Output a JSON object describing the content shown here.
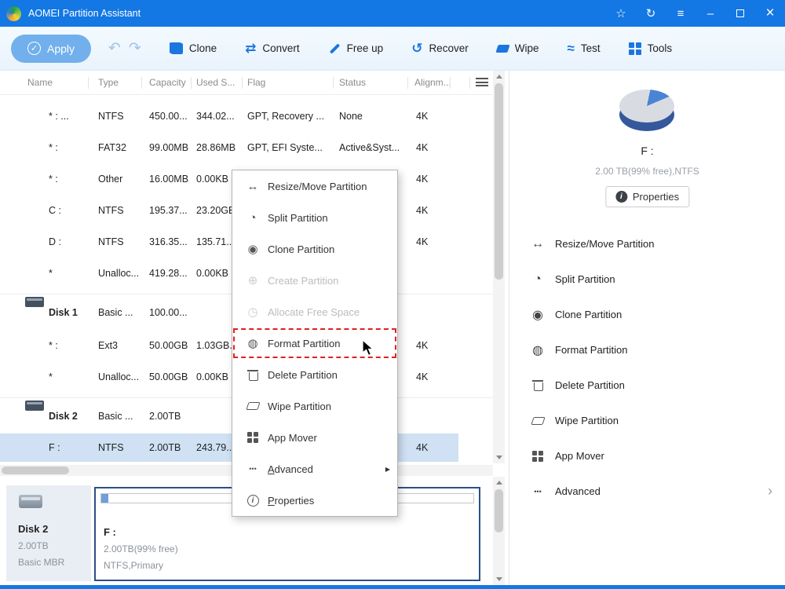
{
  "titlebar": {
    "title": "AOMEI Partition Assistant"
  },
  "icons": {
    "star": "☆",
    "refresh": "↻",
    "menu": "≡",
    "minimize": "–",
    "close": "×",
    "apply_check": "✓",
    "undo": "↶",
    "redo": "↷",
    "convert": "⇄",
    "recover": "↺",
    "test": "≈",
    "resize": "↔",
    "split": "◔",
    "clone_p": "◉",
    "create": "⊕",
    "allocate": "◷",
    "format": "◍",
    "advanced_dots": "•••",
    "submenu_arrow": "▶",
    "chevron": "›",
    "info": "i"
  },
  "toolbar": {
    "apply_label": "Apply",
    "buttons": [
      {
        "label": "Clone"
      },
      {
        "label": "Convert"
      },
      {
        "label": "Free up"
      },
      {
        "label": "Recover"
      },
      {
        "label": "Wipe"
      },
      {
        "label": "Test"
      },
      {
        "label": "Tools"
      }
    ]
  },
  "table": {
    "columns": [
      "Name",
      "Type",
      "Capacity",
      "Used S...",
      "Flag",
      "Status",
      "Alignm..."
    ],
    "rows": [
      {
        "name": "* : ...",
        "type": "NTFS",
        "capacity": "450.00...",
        "used": "344.02...",
        "flag": "GPT, Recovery ...",
        "status": "None",
        "align": "4K"
      },
      {
        "name": "* :",
        "type": "FAT32",
        "capacity": "99.00MB",
        "used": "28.86MB",
        "flag": "GPT, EFI Syste...",
        "status": "Active&Syst...",
        "align": "4K"
      },
      {
        "name": "* :",
        "type": "Other",
        "capacity": "16.00MB",
        "used": "0.00KB",
        "flag": "",
        "status": "",
        "align": "4K"
      },
      {
        "name": "C :",
        "type": "NTFS",
        "capacity": "195.37...",
        "used": "23.20GB",
        "flag": "",
        "status": "",
        "align": "4K"
      },
      {
        "name": "D :",
        "type": "NTFS",
        "capacity": "316.35...",
        "used": "135.71...",
        "flag": "",
        "status": "",
        "align": "4K"
      },
      {
        "name": "*",
        "type": "Unalloc...",
        "capacity": "419.28...",
        "used": "0.00KB",
        "flag": "",
        "status": "",
        "align": ""
      },
      {
        "name": "Disk 1",
        "type": "Basic ...",
        "capacity": "100.00...",
        "used": "",
        "flag": "",
        "status": "",
        "align": ""
      },
      {
        "name": "* :",
        "type": "Ext3",
        "capacity": "50.00GB",
        "used": "1.03GB...",
        "flag": "",
        "status": "",
        "align": "4K"
      },
      {
        "name": "*",
        "type": "Unalloc...",
        "capacity": "50.00GB",
        "used": "0.00KB",
        "flag": "",
        "status": "",
        "align": "4K"
      },
      {
        "name": "Disk 2",
        "type": "Basic ...",
        "capacity": "2.00TB",
        "used": "",
        "flag": "",
        "status": "",
        "align": ""
      },
      {
        "name": "F :",
        "type": "NTFS",
        "capacity": "2.00TB",
        "used": "243.79...",
        "flag": "",
        "status": "",
        "align": "4K"
      }
    ]
  },
  "context_menu": {
    "items": [
      {
        "label": "Resize/Move Partition",
        "enabled": true
      },
      {
        "label": "Split Partition",
        "enabled": true
      },
      {
        "label": "Clone Partition",
        "enabled": true
      },
      {
        "label": "Create Partition",
        "enabled": false
      },
      {
        "label": "Allocate Free Space",
        "enabled": false
      },
      {
        "label": "Format Partition",
        "enabled": true,
        "highlighted": true
      },
      {
        "label": "Delete Partition",
        "enabled": true
      },
      {
        "label": "Wipe Partition",
        "enabled": true
      },
      {
        "label": "App Mover",
        "enabled": true
      },
      {
        "label": "Advanced",
        "enabled": true,
        "submenu": true
      },
      {
        "label": "Properties",
        "enabled": true
      }
    ]
  },
  "right_panel": {
    "partition_name": "F :",
    "partition_info": "2.00 TB(99% free),NTFS",
    "properties_label": "Properties",
    "actions": [
      {
        "label": "Resize/Move Partition"
      },
      {
        "label": "Split Partition"
      },
      {
        "label": "Clone Partition"
      },
      {
        "label": "Format Partition"
      },
      {
        "label": "Delete Partition"
      },
      {
        "label": "Wipe Partition"
      },
      {
        "label": "App Mover"
      },
      {
        "label": "Advanced",
        "chevron": true
      }
    ]
  },
  "bottom_panel": {
    "disk_name": "Disk 2",
    "disk_size": "2.00TB",
    "disk_type": "Basic MBR",
    "partition_name": "F :",
    "partition_size": "2.00TB(99% free)",
    "partition_fs": "NTFS,Primary"
  },
  "colors": {
    "titlebar_blue": "#1377e4",
    "accent_blue": "#1b76e0",
    "selection_blue": "#cfe1f3",
    "highlight_red": "#e02020",
    "partition_border": "#2d4f86"
  }
}
